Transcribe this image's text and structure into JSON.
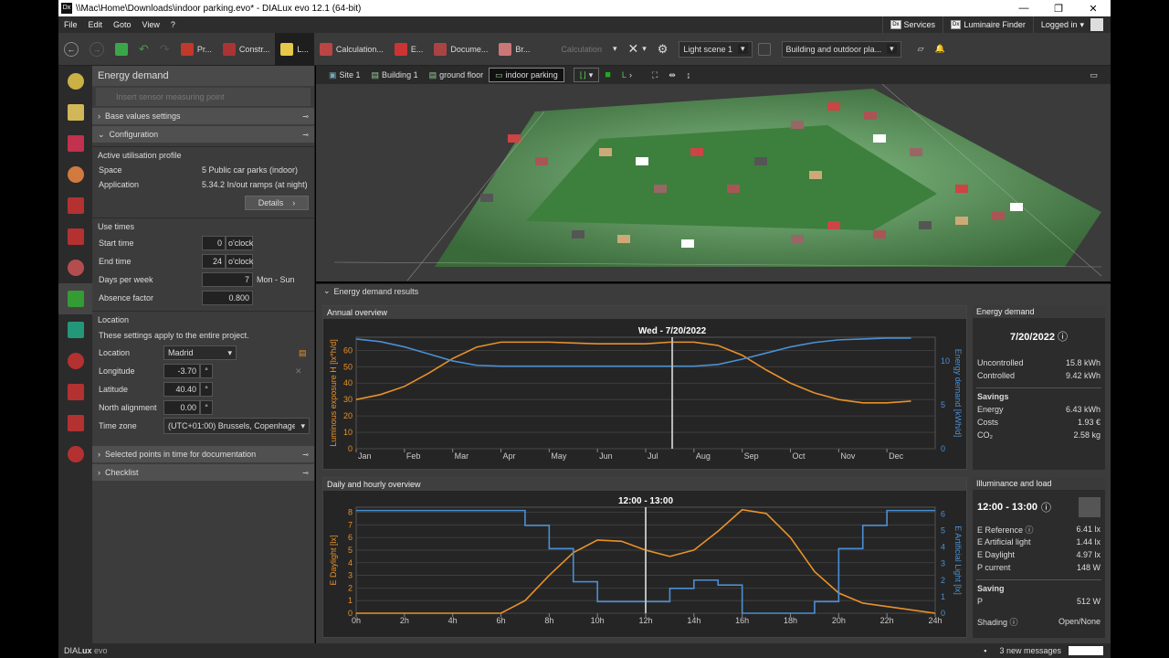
{
  "window": {
    "title": "\\\\Mac\\Home\\Downloads\\indoor parking.evo* - DIALux evo 12.1  (64-bit)",
    "app_icon": "Dx",
    "controls": [
      "—",
      "❐",
      "✕"
    ]
  },
  "menu": {
    "items": [
      "File",
      "Edit",
      "Goto",
      "View",
      "?"
    ],
    "services": "Services",
    "luminaire_finder": "Luminaire Finder",
    "logged_in": "Logged in"
  },
  "toolbar": {
    "tabs": [
      {
        "label": "Pr...",
        "color": "#c0392b"
      },
      {
        "label": "Constr...",
        "color": "#c0392b"
      },
      {
        "label": "L...",
        "color": "#e6c84a"
      },
      {
        "label": "Calculation...",
        "color": "#c0392b"
      },
      {
        "label": "E...",
        "color": "#c0392b"
      },
      {
        "label": "Docume...",
        "color": "#c0392b"
      },
      {
        "label": "Br...",
        "color": "#c0392b"
      }
    ],
    "calculation": "Calculation",
    "light_scene": "Light scene 1",
    "view_select": "Building and outdoor pla..."
  },
  "left_icons": [
    "lamp-icon",
    "bulb-icon",
    "magnet-icon",
    "color-icon",
    "ramp-icon",
    "floor-icon",
    "wrench-icon",
    "leaf-icon",
    "display-icon",
    "text-icon",
    "split-icon",
    "rectangle-icon",
    "tree-icon"
  ],
  "panel": {
    "title": "Energy demand",
    "sensor": "Insert sensor measuring point",
    "sections": {
      "base": "Base values settings",
      "config": "Configuration",
      "selected": "Selected points in time for documentation",
      "checklist": "Checklist"
    },
    "profile": {
      "heading": "Active utilisation profile",
      "space_label": "Space",
      "space": "5 Public car parks (indoor)",
      "app_label": "Application",
      "app": "5.34.2 In/out ramps (at night)",
      "details": "Details"
    },
    "use_times": {
      "heading": "Use times",
      "start_label": "Start time",
      "start": "0",
      "start_unit": "o'clock",
      "end_label": "End time",
      "end": "24",
      "end_unit": "o'clock",
      "days_label": "Days per week",
      "days": "7",
      "days_unit": "Mon - Sun",
      "absence_label": "Absence factor",
      "absence": "0.800"
    },
    "location": {
      "heading": "Location",
      "note": "These settings apply to the entire project.",
      "loc_label": "Location",
      "loc": "Madrid",
      "lon_label": "Longitude",
      "lon": "-3.70",
      "lat_label": "Latitude",
      "lat": "40.40",
      "north_label": "North alignment",
      "north": "0.00",
      "tz_label": "Time zone",
      "tz": "(UTC+01:00) Brussels, Copenhagen",
      "deg": "°"
    }
  },
  "breadcrumbs": [
    "Site 1",
    "Building 1",
    "ground floor",
    "indoor parking"
  ],
  "results": {
    "heading": "Energy demand results",
    "annual": {
      "title": "Annual overview",
      "marker": "Wed - 7/20/2022",
      "ylabel_left": "Luminous exposure H [lx*h/d]",
      "ylabel_right": "Energy demand [kWh/d]"
    },
    "daily": {
      "title": "Daily and hourly overview",
      "marker": "12:00 - 13:00",
      "ylabel_left": "E Daylight [lx]",
      "ylabel_right": "E Artificial Light [lx]"
    },
    "energy": {
      "title": "Energy demand",
      "date": "7/20/2022",
      "uncontrolled_label": "Uncontrolled",
      "uncontrolled": "15.8 kWh",
      "controlled_label": "Controlled",
      "controlled": "9.42 kWh",
      "savings": "Savings",
      "energy_label": "Energy",
      "energy": "6.43 kWh",
      "costs_label": "Costs",
      "costs": "1.93 €",
      "co2_label": "CO₂",
      "co2": "2.58 kg"
    },
    "illum": {
      "title": "Illuminance and load",
      "time": "12:00 - 13:00",
      "eref_label": "E Reference",
      "eref": "6.41 lx",
      "eart_label": "E Artificial light",
      "eart": "1.44 lx",
      "eday_label": "E Daylight",
      "eday": "4.97 lx",
      "pcur_label": "P current",
      "pcur": "148 W",
      "saving": "Saving",
      "p_label": "P",
      "p": "512 W",
      "shading_label": "Shading",
      "shading": "Open/None"
    }
  },
  "status": {
    "brand_a": "DIAL",
    "brand_b": "ux",
    "brand_c": " evo",
    "messages": "3 new messages"
  },
  "colors": {
    "orange": "#e8912a",
    "blue": "#4a8fd4"
  },
  "chart_data": [
    {
      "type": "line",
      "title": "Annual overview",
      "categories": [
        "Jan",
        "Feb",
        "Mar",
        "Apr",
        "May",
        "Jun",
        "Jul",
        "Aug",
        "Sep",
        "Oct",
        "Nov",
        "Dec"
      ],
      "xlabel": "",
      "ylabel": "Luminous exposure H [lx*h/d]",
      "ylim": [
        0,
        68
      ],
      "y2label": "Energy demand [kWh/d]",
      "y2lim": [
        0,
        12.7
      ],
      "left_ticks": [
        0,
        10,
        20,
        30,
        40,
        50,
        60
      ],
      "right_ticks": [
        0,
        5,
        10
      ],
      "series": [
        {
          "axis": "left",
          "color": "#e8912a",
          "x": [
            0,
            0.5,
            1,
            1.5,
            2,
            2.5,
            3,
            3.5,
            4,
            4.5,
            5,
            5.5,
            6,
            6.5,
            7,
            7.5,
            8,
            8.5,
            9,
            9.5,
            10,
            10.5,
            11,
            11.5
          ],
          "values": [
            30,
            33,
            38,
            46,
            55,
            62,
            65,
            65,
            65,
            64.5,
            64,
            64,
            64,
            65,
            65,
            63,
            57,
            48,
            40,
            34,
            30,
            28,
            28,
            29
          ]
        },
        {
          "axis": "right",
          "color": "#4a8fd4",
          "x": [
            0,
            0.5,
            1,
            1.5,
            2,
            2.5,
            3,
            3.5,
            4,
            4.5,
            5,
            5.5,
            6,
            6.5,
            7,
            7.5,
            8,
            8.5,
            9,
            9.5,
            10,
            10.5,
            11,
            11.5
          ],
          "values": [
            12.5,
            12.2,
            11.6,
            10.8,
            10.0,
            9.5,
            9.4,
            9.4,
            9.4,
            9.4,
            9.4,
            9.4,
            9.4,
            9.4,
            9.4,
            9.6,
            10.2,
            10.9,
            11.6,
            12.1,
            12.4,
            12.5,
            12.6,
            12.6
          ]
        }
      ]
    },
    {
      "type": "line",
      "title": "Daily and hourly overview",
      "categories": [
        "0h",
        "2h",
        "4h",
        "6h",
        "8h",
        "10h",
        "12h",
        "14h",
        "16h",
        "18h",
        "20h",
        "22h",
        "24h"
      ],
      "xlabel": "",
      "ylabel": "E Daylight [lx]",
      "ylim": [
        0,
        8.4
      ],
      "y2label": "E Artificial Light [lx]",
      "y2lim": [
        0,
        6.4
      ],
      "left_ticks": [
        0,
        1,
        2,
        3,
        4,
        5,
        6,
        7,
        8
      ],
      "right_ticks": [
        0,
        1,
        2,
        3,
        4,
        5,
        6
      ],
      "series": [
        {
          "axis": "left",
          "color": "#e8912a",
          "x": [
            0,
            6,
            7,
            8,
            9,
            10,
            11,
            12,
            13,
            14,
            15,
            16,
            17,
            18,
            19,
            20,
            21,
            24
          ],
          "values": [
            0,
            0,
            1,
            3,
            4.8,
            5.8,
            5.7,
            5,
            4.5,
            5,
            6.5,
            8.2,
            7.9,
            6,
            3.3,
            1.6,
            0.8,
            0
          ]
        },
        {
          "axis": "right",
          "color": "#4a8fd4",
          "step": true,
          "x": [
            0,
            7,
            8,
            9,
            10,
            11,
            12,
            13,
            14,
            15,
            16,
            17,
            18,
            19,
            20,
            21,
            22,
            23,
            24
          ],
          "values": [
            6.2,
            5.3,
            3.9,
            1.9,
            0.7,
            0.7,
            0.7,
            1.5,
            2.0,
            1.7,
            0,
            0,
            0,
            0.7,
            3.9,
            5.3,
            6.2,
            6.2,
            6.2
          ]
        }
      ]
    }
  ]
}
